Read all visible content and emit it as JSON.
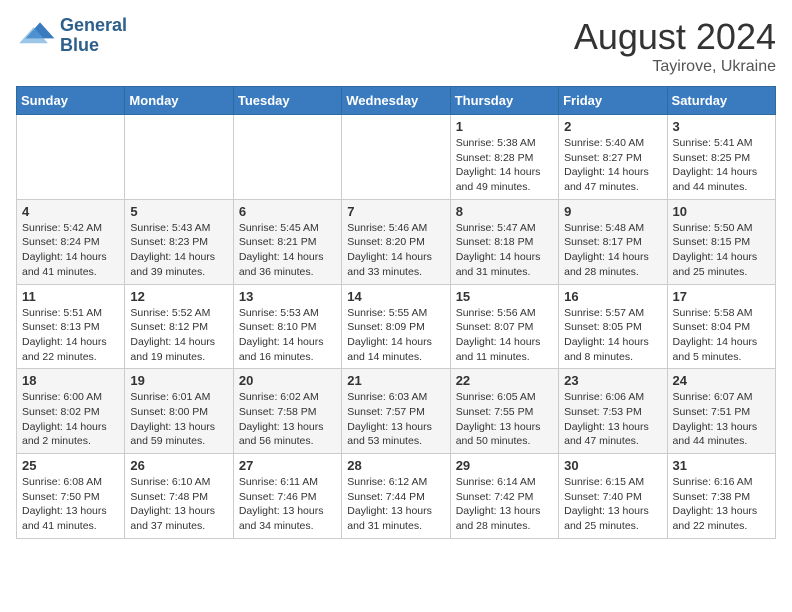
{
  "header": {
    "logo_line1": "General",
    "logo_line2": "Blue",
    "month_title": "August 2024",
    "location": "Tayirove, Ukraine"
  },
  "weekdays": [
    "Sunday",
    "Monday",
    "Tuesday",
    "Wednesday",
    "Thursday",
    "Friday",
    "Saturday"
  ],
  "weeks": [
    [
      {
        "day": "",
        "info": ""
      },
      {
        "day": "",
        "info": ""
      },
      {
        "day": "",
        "info": ""
      },
      {
        "day": "",
        "info": ""
      },
      {
        "day": "1",
        "info": "Sunrise: 5:38 AM\nSunset: 8:28 PM\nDaylight: 14 hours\nand 49 minutes."
      },
      {
        "day": "2",
        "info": "Sunrise: 5:40 AM\nSunset: 8:27 PM\nDaylight: 14 hours\nand 47 minutes."
      },
      {
        "day": "3",
        "info": "Sunrise: 5:41 AM\nSunset: 8:25 PM\nDaylight: 14 hours\nand 44 minutes."
      }
    ],
    [
      {
        "day": "4",
        "info": "Sunrise: 5:42 AM\nSunset: 8:24 PM\nDaylight: 14 hours\nand 41 minutes."
      },
      {
        "day": "5",
        "info": "Sunrise: 5:43 AM\nSunset: 8:23 PM\nDaylight: 14 hours\nand 39 minutes."
      },
      {
        "day": "6",
        "info": "Sunrise: 5:45 AM\nSunset: 8:21 PM\nDaylight: 14 hours\nand 36 minutes."
      },
      {
        "day": "7",
        "info": "Sunrise: 5:46 AM\nSunset: 8:20 PM\nDaylight: 14 hours\nand 33 minutes."
      },
      {
        "day": "8",
        "info": "Sunrise: 5:47 AM\nSunset: 8:18 PM\nDaylight: 14 hours\nand 31 minutes."
      },
      {
        "day": "9",
        "info": "Sunrise: 5:48 AM\nSunset: 8:17 PM\nDaylight: 14 hours\nand 28 minutes."
      },
      {
        "day": "10",
        "info": "Sunrise: 5:50 AM\nSunset: 8:15 PM\nDaylight: 14 hours\nand 25 minutes."
      }
    ],
    [
      {
        "day": "11",
        "info": "Sunrise: 5:51 AM\nSunset: 8:13 PM\nDaylight: 14 hours\nand 22 minutes."
      },
      {
        "day": "12",
        "info": "Sunrise: 5:52 AM\nSunset: 8:12 PM\nDaylight: 14 hours\nand 19 minutes."
      },
      {
        "day": "13",
        "info": "Sunrise: 5:53 AM\nSunset: 8:10 PM\nDaylight: 14 hours\nand 16 minutes."
      },
      {
        "day": "14",
        "info": "Sunrise: 5:55 AM\nSunset: 8:09 PM\nDaylight: 14 hours\nand 14 minutes."
      },
      {
        "day": "15",
        "info": "Sunrise: 5:56 AM\nSunset: 8:07 PM\nDaylight: 14 hours\nand 11 minutes."
      },
      {
        "day": "16",
        "info": "Sunrise: 5:57 AM\nSunset: 8:05 PM\nDaylight: 14 hours\nand 8 minutes."
      },
      {
        "day": "17",
        "info": "Sunrise: 5:58 AM\nSunset: 8:04 PM\nDaylight: 14 hours\nand 5 minutes."
      }
    ],
    [
      {
        "day": "18",
        "info": "Sunrise: 6:00 AM\nSunset: 8:02 PM\nDaylight: 14 hours\nand 2 minutes."
      },
      {
        "day": "19",
        "info": "Sunrise: 6:01 AM\nSunset: 8:00 PM\nDaylight: 13 hours\nand 59 minutes."
      },
      {
        "day": "20",
        "info": "Sunrise: 6:02 AM\nSunset: 7:58 PM\nDaylight: 13 hours\nand 56 minutes."
      },
      {
        "day": "21",
        "info": "Sunrise: 6:03 AM\nSunset: 7:57 PM\nDaylight: 13 hours\nand 53 minutes."
      },
      {
        "day": "22",
        "info": "Sunrise: 6:05 AM\nSunset: 7:55 PM\nDaylight: 13 hours\nand 50 minutes."
      },
      {
        "day": "23",
        "info": "Sunrise: 6:06 AM\nSunset: 7:53 PM\nDaylight: 13 hours\nand 47 minutes."
      },
      {
        "day": "24",
        "info": "Sunrise: 6:07 AM\nSunset: 7:51 PM\nDaylight: 13 hours\nand 44 minutes."
      }
    ],
    [
      {
        "day": "25",
        "info": "Sunrise: 6:08 AM\nSunset: 7:50 PM\nDaylight: 13 hours\nand 41 minutes."
      },
      {
        "day": "26",
        "info": "Sunrise: 6:10 AM\nSunset: 7:48 PM\nDaylight: 13 hours\nand 37 minutes."
      },
      {
        "day": "27",
        "info": "Sunrise: 6:11 AM\nSunset: 7:46 PM\nDaylight: 13 hours\nand 34 minutes."
      },
      {
        "day": "28",
        "info": "Sunrise: 6:12 AM\nSunset: 7:44 PM\nDaylight: 13 hours\nand 31 minutes."
      },
      {
        "day": "29",
        "info": "Sunrise: 6:14 AM\nSunset: 7:42 PM\nDaylight: 13 hours\nand 28 minutes."
      },
      {
        "day": "30",
        "info": "Sunrise: 6:15 AM\nSunset: 7:40 PM\nDaylight: 13 hours\nand 25 minutes."
      },
      {
        "day": "31",
        "info": "Sunrise: 6:16 AM\nSunset: 7:38 PM\nDaylight: 13 hours\nand 22 minutes."
      }
    ]
  ]
}
